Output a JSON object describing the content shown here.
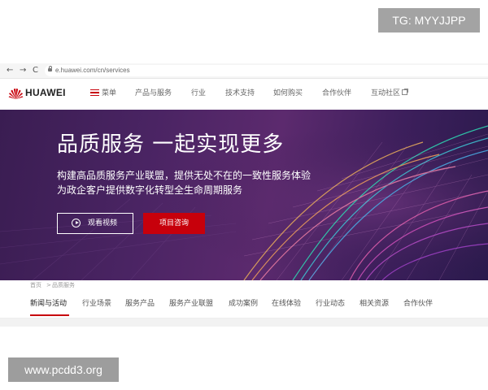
{
  "watermarks": {
    "top": "TG: MYYJJPP",
    "bottom": "www.pcdd3.org"
  },
  "browser": {
    "url": "e.huawei.com/cn/services",
    "nav": {
      "back": "←",
      "forward": "→",
      "reload": "C"
    }
  },
  "header": {
    "logo_text": "HUAWEI",
    "menu_label": "菜单",
    "nav_items": [
      "产品与服务",
      "行业",
      "技术支持",
      "如何购买",
      "合作伙伴",
      "互动社区"
    ]
  },
  "banner": {
    "title": "品质服务 一起实现更多",
    "subtitle_line1": "构建高品质服务产业联盟，提供无处不在的一致性服务体验",
    "subtitle_line2": "为政企客户提供数字化转型全生命周期服务",
    "btn_video": "观看视频",
    "btn_consult": "项目咨询"
  },
  "breadcrumb": {
    "home": "首页",
    "separator": ">",
    "current": "品质服务"
  },
  "tabs": [
    "新闻与活动",
    "行业场景",
    "服务产品",
    "服务产业联盟",
    "成功案例",
    "在线体验",
    "行业动态",
    "相关资源",
    "合作伙伴"
  ],
  "colors": {
    "brand_red": "#c7000b",
    "banner_base": "#4a2463",
    "watermark_grey": "#a3a3a3"
  },
  "icons": {
    "menu": "hamburger-icon",
    "play": "play-circle-icon",
    "external": "external-link-icon",
    "lock": "lock-icon"
  }
}
